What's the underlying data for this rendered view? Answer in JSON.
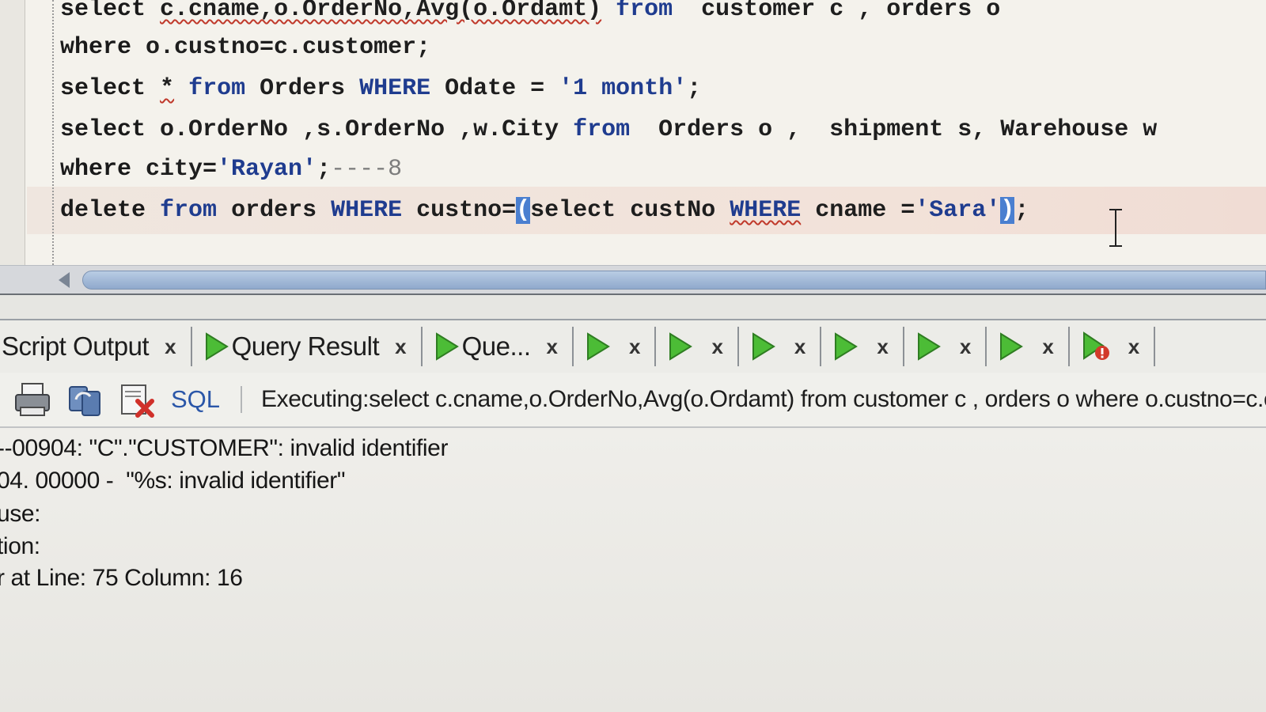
{
  "editor": {
    "line1": {
      "kw_select": "select",
      "cols": "c.cname,o.OrderNo,Avg(o.Ordamt)",
      "from": "from",
      "tables": "  customer c , orders o"
    },
    "line2": {
      "kw_where": "where",
      "cond": " o.custno=c.customer;"
    },
    "line3": {
      "kw_select": "select",
      "star": "*",
      "from": "from",
      "table": " Orders ",
      "where": "WHERE",
      "col": " Odate = ",
      "str": "'1 month'",
      "end": ";"
    },
    "line4": {
      "kw_select": "select",
      "cols": " o.OrderNo ,s.OrderNo ,w.City ",
      "from": "from",
      "tables": "  Orders o ,  shipment s, Warehouse w"
    },
    "line5": {
      "kw_where": "where",
      "cond": " city=",
      "str": "'Rayan'",
      "end": ";",
      "comment": "----8"
    },
    "line6": {
      "kw_delete": "delete",
      "from": "from",
      "table": " orders ",
      "where": "WHERE",
      "cond": " custno=",
      "open_paren": "(",
      "sub_select": "select",
      "sub_col": " custNo ",
      "sub_where": "WHERE",
      "sub_cond": " cname =",
      "str": "'Sara'",
      "close_paren": ")",
      "end": ";"
    }
  },
  "tabs": [
    {
      "label": "Script Output",
      "icon": "none"
    },
    {
      "label": "Query Result",
      "icon": "play-icon"
    },
    {
      "label": "Que...",
      "icon": "play-icon"
    },
    {
      "label": "",
      "icon": "play-icon"
    },
    {
      "label": "",
      "icon": "play-icon"
    },
    {
      "label": "",
      "icon": "play-icon"
    },
    {
      "label": "",
      "icon": "play-icon"
    },
    {
      "label": "",
      "icon": "play-icon"
    },
    {
      "label": "",
      "icon": "play-icon"
    },
    {
      "label": "",
      "icon": "stop-run-icon"
    }
  ],
  "tab_close_glyph": "x",
  "toolbar": {
    "sql_label": "SQL",
    "status": "Executing:select c.cname,o.OrderNo,Avg(o.Ordamt) from  customer c , orders o where o.custno=c.customer"
  },
  "output": {
    "lines": [
      "‑-00904: \"C\".\"CUSTOMER\": invalid identifier",
      "04. 00000 -  \"%s: invalid identifier\"",
      "use:",
      "tion:",
      "r at Line: 75 Column: 16"
    ]
  },
  "colors": {
    "keyword_blue": "#1f3c8f",
    "play_green": "#3fae2a",
    "selection_blue": "#4a7fd0",
    "error_red": "#c0392b"
  }
}
